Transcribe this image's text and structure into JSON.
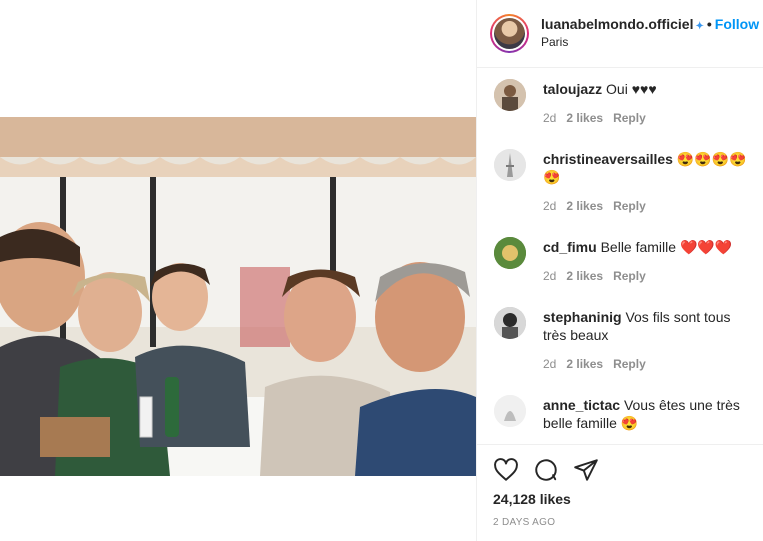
{
  "post": {
    "username": "luanabelmondo.officiel",
    "separator": "•",
    "follow_label": "Follow",
    "location": "Paris",
    "likes_text": "24,128 likes",
    "date_text": "2 DAYS AGO"
  },
  "comments": [
    {
      "user": "taloujazz",
      "text": "Oui ♥♥♥",
      "age": "2d",
      "likes": "2 likes",
      "reply": "Reply"
    },
    {
      "user": "christineaversailles",
      "text": "😍😍😍😍😍",
      "age": "2d",
      "likes": "2 likes",
      "reply": "Reply"
    },
    {
      "user": "cd_fimu",
      "text": "Belle famille ❤️❤️❤️",
      "age": "2d",
      "likes": "2 likes",
      "reply": "Reply"
    },
    {
      "user": "stephaninig",
      "text": "Vos fils sont tous très beaux",
      "age": "2d",
      "likes": "2 likes",
      "reply": "Reply"
    },
    {
      "user": "anne_tictac",
      "text": "Vous êtes une très belle famille 😍",
      "age": "",
      "likes": "",
      "reply": ""
    }
  ],
  "icons": {
    "like": "heart-icon",
    "comment": "comment-icon",
    "share": "share-icon",
    "verified": "verified-badge-icon"
  }
}
